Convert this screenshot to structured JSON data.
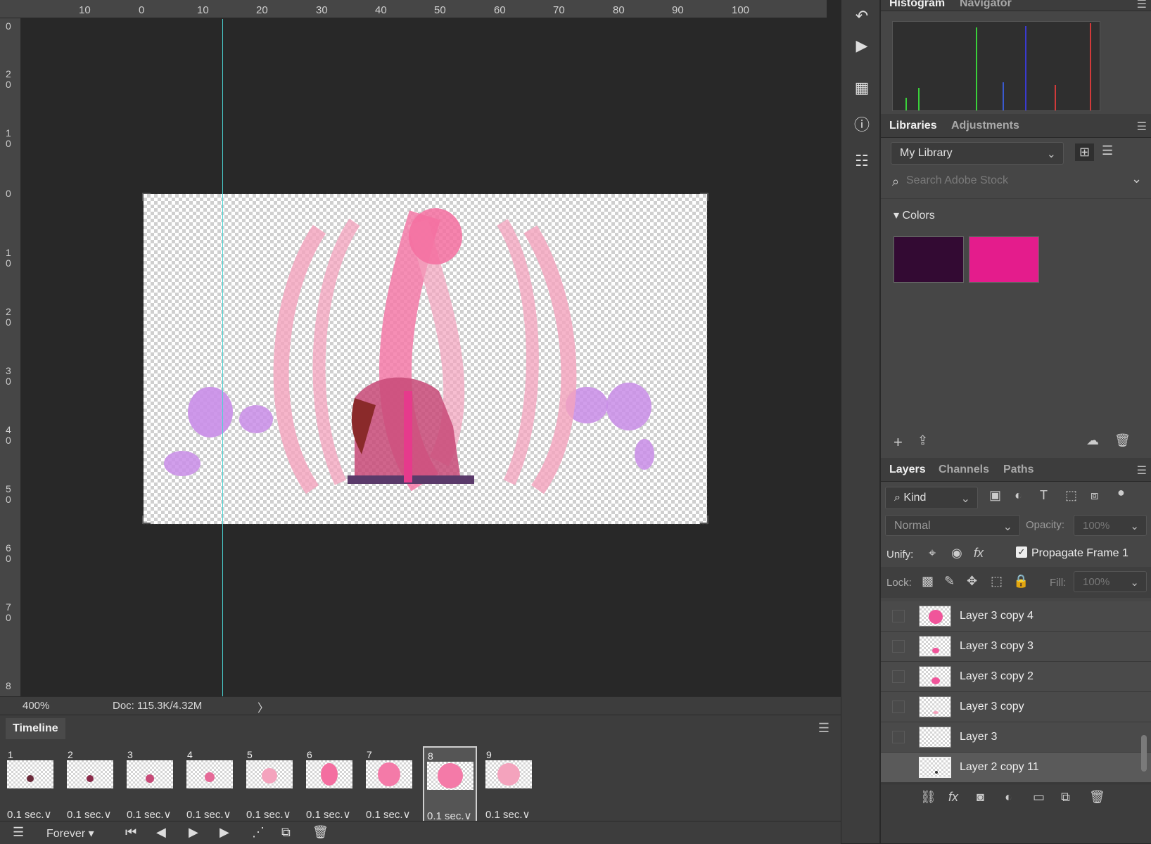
{
  "ruler_top": {
    "labels": [
      "10",
      "0",
      "10",
      "20",
      "30",
      "40",
      "50",
      "60",
      "70",
      "80",
      "90",
      "100"
    ]
  },
  "ruler_left": {
    "labels": [
      "0",
      "20",
      "10",
      "0",
      "10",
      "20",
      "30",
      "40",
      "50",
      "60",
      "70",
      "8"
    ]
  },
  "status": {
    "zoom": "400%",
    "doc": "Doc: 115.3K/4.32M",
    "arrow": "〉"
  },
  "timeline": {
    "title": "Timeline",
    "loop": "Forever",
    "frames": [
      {
        "num": "1",
        "delay": "0.1 sec.",
        "chev": "∨"
      },
      {
        "num": "2",
        "delay": "0.1 sec.",
        "chev": "∨"
      },
      {
        "num": "3",
        "delay": "0.1 sec.",
        "chev": "∨"
      },
      {
        "num": "4",
        "delay": "0.1 sec.",
        "chev": "∨"
      },
      {
        "num": "5",
        "delay": "0.1 sec.",
        "chev": "∨"
      },
      {
        "num": "6",
        "delay": "0.1 sec.",
        "chev": "∨"
      },
      {
        "num": "7",
        "delay": "0.1 sec.",
        "chev": "∨"
      },
      {
        "num": "8",
        "delay": "0.1 sec.",
        "chev": "∨"
      },
      {
        "num": "9",
        "delay": "0.1 sec.",
        "chev": "∨"
      }
    ],
    "selected_frame": "8"
  },
  "panels": {
    "histogram_tab": "Histogram",
    "navigator_tab": "Navigator",
    "libraries_tab": "Libraries",
    "adjustments_tab": "Adjustments",
    "library_name": "My Library",
    "search_placeholder": "Search Adobe Stock",
    "colors_label": "Colors",
    "layers_tab": "Layers",
    "channels_tab": "Channels",
    "paths_tab": "Paths",
    "kind_label": "Kind",
    "blend_mode": "Normal",
    "opacity_label": "Opacity:",
    "opacity_value": "100%",
    "unify_label": "Unify:",
    "propagate_label": "Propagate Frame 1",
    "lock_label": "Lock:",
    "fill_label": "Fill:",
    "fill_value": "100%"
  },
  "colors": {
    "swatch_dark": "#330a33",
    "swatch_pink": "#e41c8c",
    "accent_guide": "#4ad3d3"
  },
  "layers": [
    {
      "name": "Layer 3 copy 4"
    },
    {
      "name": "Layer 3 copy 3"
    },
    {
      "name": "Layer 3 copy 2"
    },
    {
      "name": "Layer 3 copy"
    },
    {
      "name": "Layer 3"
    },
    {
      "name": "Layer 2 copy 11"
    }
  ]
}
